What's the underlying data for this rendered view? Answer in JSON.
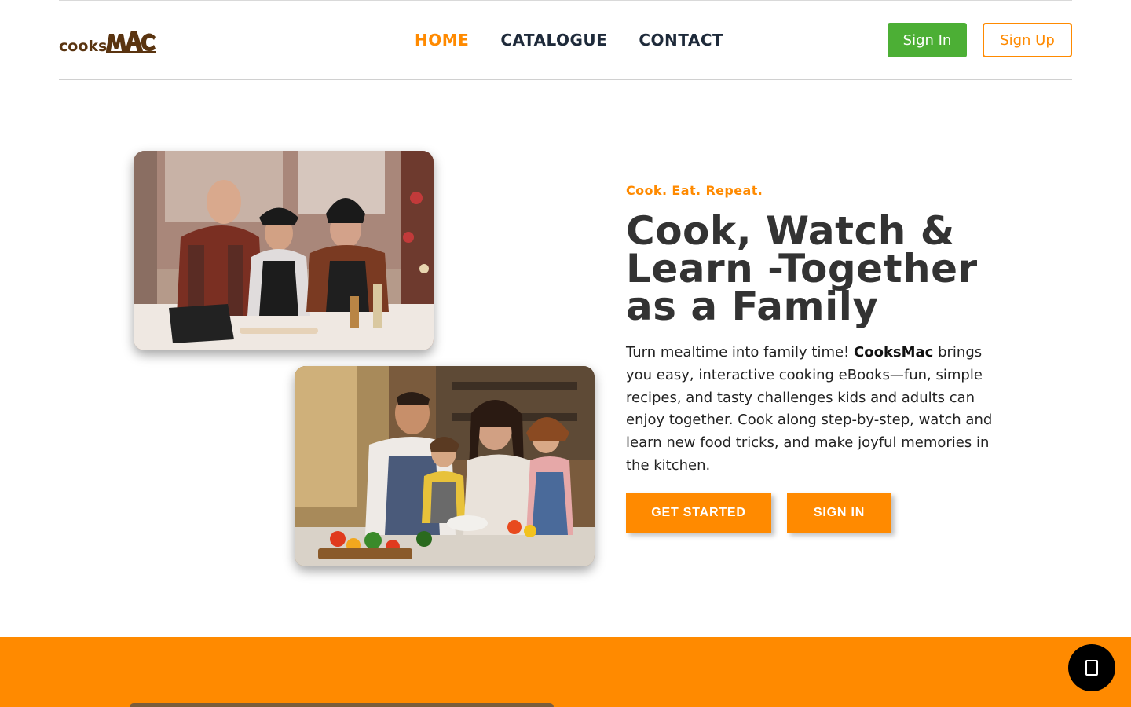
{
  "brand": {
    "name_small": "cooks",
    "name_large": "MAC"
  },
  "nav": {
    "items": [
      {
        "label": "HOME",
        "active": true
      },
      {
        "label": "CATALOGUE",
        "active": false
      },
      {
        "label": "CONTACT",
        "active": false
      }
    ]
  },
  "auth": {
    "sign_in_label": "Sign In",
    "sign_up_label": "Sign Up"
  },
  "hero": {
    "tagline": "Cook. Eat. Repeat.",
    "headline": "Cook, Watch & Learn -Together as a Family",
    "description_before": "Turn mealtime into family time! ",
    "description_brand": "CooksMac",
    "description_after": " brings you easy, interactive cooking eBooks—fun, simple recipes, and tasty challenges kids and adults can enjoy together. Cook along step-by-step, watch and learn new food tricks, and make joyful memories in the kitchen.",
    "cta_primary": "GET STARTED",
    "cta_secondary": "SIGN IN"
  },
  "colors": {
    "accent": "#ff8a00",
    "nav_text": "#1e2a3a",
    "sign_in_green": "#4caf35",
    "logo_brown": "#5a3410"
  },
  "icons": {
    "chat": "chat-icon"
  }
}
